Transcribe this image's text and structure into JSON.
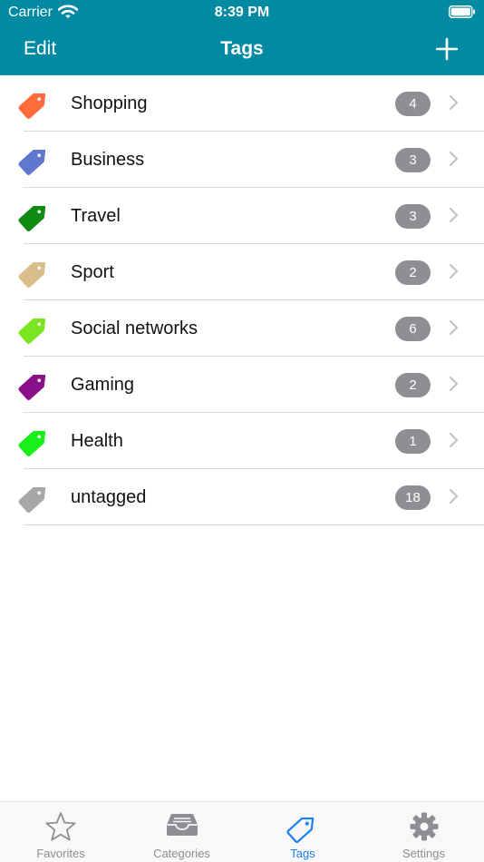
{
  "status_bar": {
    "carrier": "Carrier",
    "time": "8:39 PM"
  },
  "nav": {
    "left_label": "Edit",
    "title": "Tags",
    "add_icon": "plus-icon"
  },
  "tags": [
    {
      "name": "Shopping",
      "count": "4",
      "color": "#ff6b3a"
    },
    {
      "name": "Business",
      "count": "3",
      "color": "#5f77cf"
    },
    {
      "name": "Travel",
      "count": "3",
      "color": "#0f8a12"
    },
    {
      "name": "Sport",
      "count": "2",
      "color": "#d7be8a"
    },
    {
      "name": "Social networks",
      "count": "6",
      "color": "#7be51f"
    },
    {
      "name": "Gaming",
      "count": "2",
      "color": "#8a108a"
    },
    {
      "name": "Health",
      "count": "1",
      "color": "#19ef19"
    },
    {
      "name": "untagged",
      "count": "18",
      "color": "#a7a7a7"
    }
  ],
  "tabs": [
    {
      "label": "Favorites",
      "icon": "star-icon",
      "active": false
    },
    {
      "label": "Categories",
      "icon": "tray-icon",
      "active": false
    },
    {
      "label": "Tags",
      "icon": "tag-icon",
      "active": true
    },
    {
      "label": "Settings",
      "icon": "gear-icon",
      "active": false
    }
  ],
  "colors": {
    "nav_background": "#038aa3",
    "tab_active": "#1a7ff0",
    "tab_inactive": "#8e8e93",
    "badge": "#8e8e93"
  }
}
